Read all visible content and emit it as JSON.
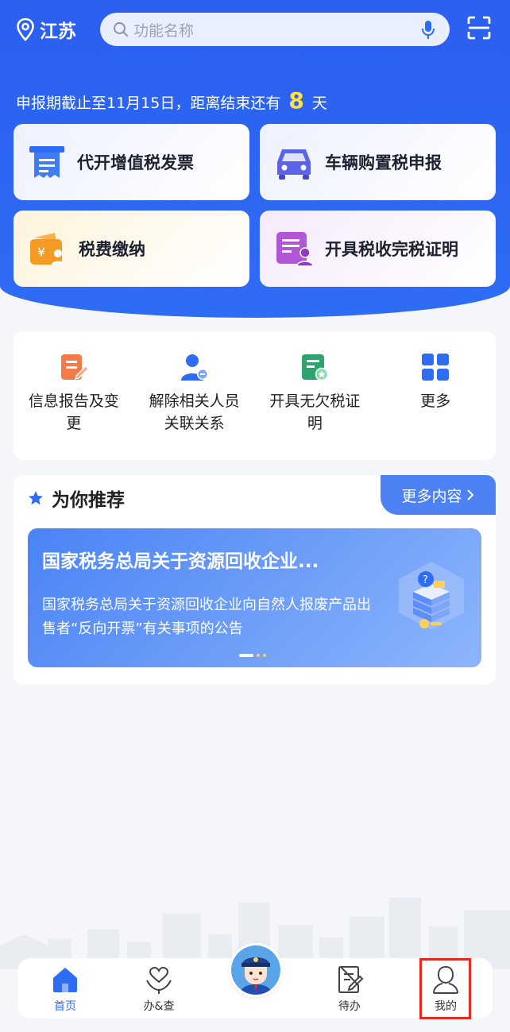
{
  "header": {
    "location": "江苏",
    "search_placeholder": "功能名称",
    "icons": [
      "location-pin-icon",
      "search-icon",
      "microphone-icon",
      "scan-icon"
    ]
  },
  "deadline": {
    "prefix": "申报期截止至11月15日，距离结束还有",
    "days": "8",
    "suffix": "天",
    "highlight_color": "#ffe14a"
  },
  "quick_cards": [
    {
      "label": "代开增值税发票",
      "icon": "invoice-icon"
    },
    {
      "label": "车辆购置税申报",
      "icon": "car-icon"
    },
    {
      "label": "税费缴纳",
      "icon": "wallet-icon"
    },
    {
      "label": "开具税收完税证明",
      "icon": "certificate-icon"
    }
  ],
  "services": [
    {
      "label": "信息报告及变更",
      "icon": "edit-document-icon"
    },
    {
      "label": "解除相关人员关联关系",
      "icon": "remove-user-icon"
    },
    {
      "label": "开具无欠税证明",
      "icon": "badge-document-icon"
    },
    {
      "label": "更多",
      "icon": "grid-icon"
    }
  ],
  "recommend": {
    "title": "为你推荐",
    "more_label": "更多内容",
    "banner_title": "国家税务总局关于资源回收企业...",
    "banner_desc": "国家税务总局关于资源回收企业向自然人报废产品出售者“反向开票”有关事项的公告"
  },
  "tabbar": {
    "tabs": [
      {
        "label": "首页",
        "icon": "home-icon",
        "active": true
      },
      {
        "label": "办&查",
        "icon": "heart-hands-icon",
        "active": false
      },
      {
        "label": "待办",
        "icon": "todo-document-icon",
        "active": false
      },
      {
        "label": "我的",
        "icon": "user-profile-icon",
        "active": false
      }
    ],
    "center_icon": "assistant-avatar-icon"
  },
  "colors": {
    "primary": "#2f6cf4",
    "highlight_box": "#e52a1f"
  }
}
